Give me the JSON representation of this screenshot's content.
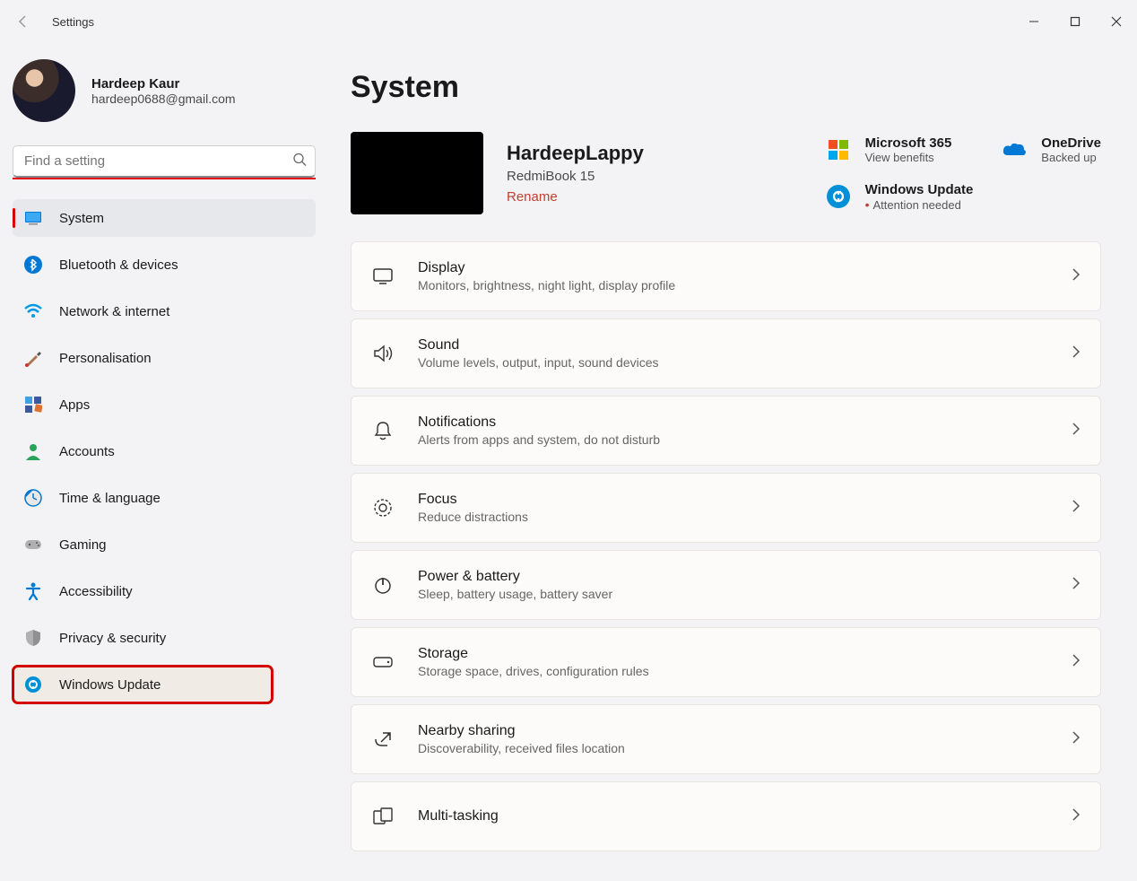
{
  "app": {
    "title": "Settings"
  },
  "profile": {
    "name": "Hardeep Kaur",
    "email": "hardeep0688@gmail.com"
  },
  "search": {
    "placeholder": "Find a setting"
  },
  "nav": [
    {
      "id": "system",
      "label": "System",
      "active": true
    },
    {
      "id": "bluetooth",
      "label": "Bluetooth & devices"
    },
    {
      "id": "network",
      "label": "Network & internet"
    },
    {
      "id": "personalisation",
      "label": "Personalisation"
    },
    {
      "id": "apps",
      "label": "Apps"
    },
    {
      "id": "accounts",
      "label": "Accounts"
    },
    {
      "id": "time",
      "label": "Time & language"
    },
    {
      "id": "gaming",
      "label": "Gaming"
    },
    {
      "id": "accessibility",
      "label": "Accessibility"
    },
    {
      "id": "privacy",
      "label": "Privacy & security"
    },
    {
      "id": "update",
      "label": "Windows Update",
      "highlighted": true
    }
  ],
  "page": {
    "title": "System"
  },
  "device": {
    "name": "HardeepLappy",
    "model": "RedmiBook 15",
    "rename": "Rename"
  },
  "quicklinks": {
    "m365": {
      "title": "Microsoft 365",
      "sub": "View benefits"
    },
    "onedrive": {
      "title": "OneDrive",
      "sub": "Backed up"
    },
    "update": {
      "title": "Windows Update",
      "sub": "Attention needed"
    }
  },
  "cards": [
    {
      "id": "display",
      "title": "Display",
      "sub": "Monitors, brightness, night light, display profile"
    },
    {
      "id": "sound",
      "title": "Sound",
      "sub": "Volume levels, output, input, sound devices"
    },
    {
      "id": "notifications",
      "title": "Notifications",
      "sub": "Alerts from apps and system, do not disturb"
    },
    {
      "id": "focus",
      "title": "Focus",
      "sub": "Reduce distractions"
    },
    {
      "id": "power",
      "title": "Power & battery",
      "sub": "Sleep, battery usage, battery saver"
    },
    {
      "id": "storage",
      "title": "Storage",
      "sub": "Storage space, drives, configuration rules"
    },
    {
      "id": "nearby",
      "title": "Nearby sharing",
      "sub": "Discoverability, received files location"
    },
    {
      "id": "multitask",
      "title": "Multi-tasking",
      "sub": ""
    }
  ]
}
